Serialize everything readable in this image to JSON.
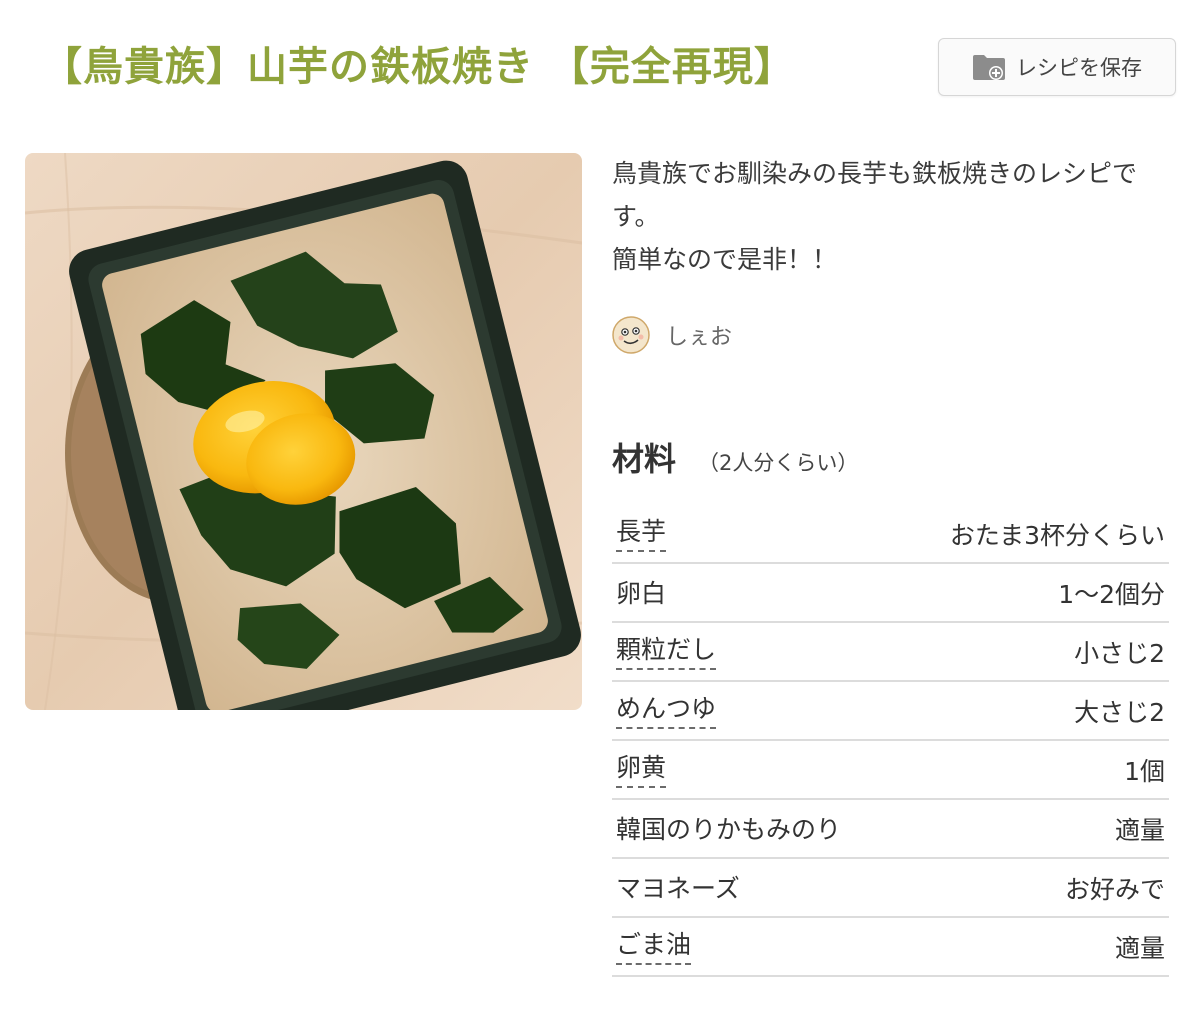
{
  "recipe": {
    "title": "【鳥貴族】山芋の鉄板焼き 【完全再現】",
    "title_color": "#8fa33b"
  },
  "save_button": {
    "label": "レシピを保存",
    "icon": "folder-add-icon"
  },
  "photo": {
    "alt": "山芋の鉄板焼き"
  },
  "description": {
    "line1": "鳥貴族でお馴染みの長芋も鉄板焼きのレシピです。",
    "line2": "簡単なので是非！！"
  },
  "author": {
    "name": "しぇお",
    "avatar_icon": "face-avatar-icon"
  },
  "ingredients": {
    "title": "材料",
    "servings": "（2人分くらい）",
    "items": [
      {
        "name": "長芋",
        "qty": "おたま3杯分くらい",
        "linked": true
      },
      {
        "name": "卵白",
        "qty": "1〜2個分",
        "linked": false
      },
      {
        "name": "顆粒だし",
        "qty": "小さじ2",
        "linked": true
      },
      {
        "name": "めんつゆ",
        "qty": "大さじ2",
        "linked": true
      },
      {
        "name": "卵黄",
        "qty": "1個",
        "linked": true
      },
      {
        "name": "韓国のりかもみのり",
        "qty": "適量",
        "linked": false
      },
      {
        "name": "マヨネーズ",
        "qty": "お好みで",
        "linked": false
      },
      {
        "name": "ごま油",
        "qty": "適量",
        "linked": true
      }
    ]
  }
}
